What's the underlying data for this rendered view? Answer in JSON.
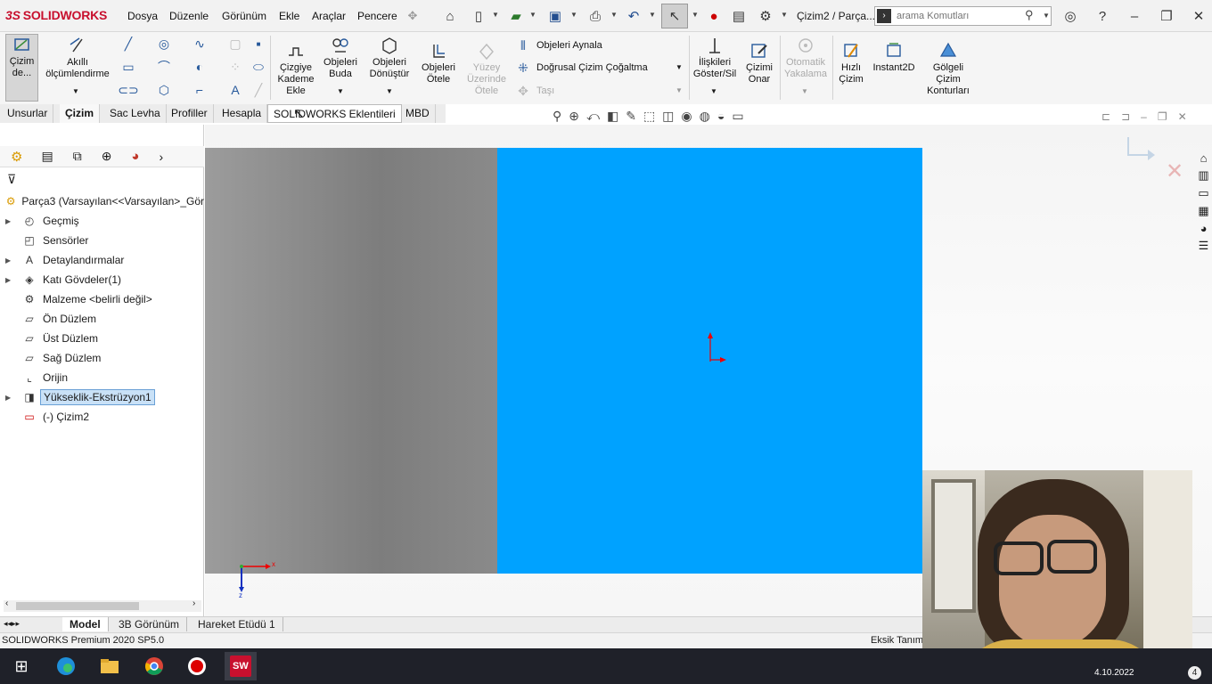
{
  "app": {
    "logo": "SOLIDWORKS",
    "logo_prefix": "3S",
    "doc_title": "Çizim2 / Parça..."
  },
  "menu": [
    "Dosya",
    "Düzenle",
    "Görünüm",
    "Ekle",
    "Araçlar",
    "Pencere"
  ],
  "search": {
    "placeholder": "arama Komutları"
  },
  "ribbon": {
    "sketch": "Çizim de...",
    "smart_dim": "Akıllı ölçümlendirme",
    "offset_line": "Çizgiye Kademe Ekle",
    "trim": "Objeleri Buda",
    "convert": "Objeleri Dönüştür",
    "offset": "Objeleri Ötele",
    "offset_surface": "Yüzey Üzerinde Ötele",
    "mirror": "Objeleri Aynala",
    "linear_pattern": "Doğrusal Çizim Çoğaltma",
    "move": "Taşı",
    "relations": "İlişkileri Göster/Sil",
    "repair": "Çizimi Onar",
    "quick_snaps": "Otomatik Yakalama",
    "rapid_sketch": "Hızlı Çizim",
    "instant2d": "Instant2D",
    "shaded": "Gölgeli Çizim Konturları"
  },
  "tabs": [
    "Unsurlar",
    "Çizim",
    "Sac Levha",
    "Profiller",
    "Hesapla",
    "SOLIDWORKS Eklentileri",
    "MBD"
  ],
  "active_tab": "Çizim",
  "tree": {
    "root": "Parça3  (Varsayılan<<Varsayılan>_Gör",
    "items": [
      {
        "label": "Geçmiş",
        "icon": "history-icon",
        "expandable": true
      },
      {
        "label": "Sensörler",
        "icon": "sensor-icon",
        "expandable": false
      },
      {
        "label": "Detaylandırmalar",
        "icon": "annotation-icon",
        "expandable": true
      },
      {
        "label": "Katı Gövdeler(1)",
        "icon": "solid-body-icon",
        "expandable": true
      },
      {
        "label": "Malzeme <belirli değil>",
        "icon": "material-icon",
        "expandable": false
      },
      {
        "label": "Ön Düzlem",
        "icon": "plane-icon",
        "expandable": false
      },
      {
        "label": "Üst Düzlem",
        "icon": "plane-icon",
        "expandable": false
      },
      {
        "label": "Sağ Düzlem",
        "icon": "plane-icon",
        "expandable": false
      },
      {
        "label": "Orijin",
        "icon": "origin-icon",
        "expandable": false
      },
      {
        "label": "Yükseklik-Ekstrüzyon1",
        "icon": "extrude-icon",
        "expandable": true,
        "selected": true
      },
      {
        "label": "(-) Çizim2",
        "icon": "sketch-icon",
        "expandable": false
      }
    ]
  },
  "bottom_tabs": [
    "Model",
    "3B Görünüm",
    "Hareket Etüdü 1"
  ],
  "status": {
    "left": "SOLIDWORKS Premium 2020 SP5.0",
    "right": "Eksik Tanım"
  },
  "taskbar": {
    "date": "4.10.2022",
    "badge": "4"
  },
  "triad": {
    "x": "x",
    "z": "z"
  },
  "colors": {
    "part_face": "#00a2ff",
    "selection": "#c9e1f7",
    "logo": "#c8102e"
  }
}
